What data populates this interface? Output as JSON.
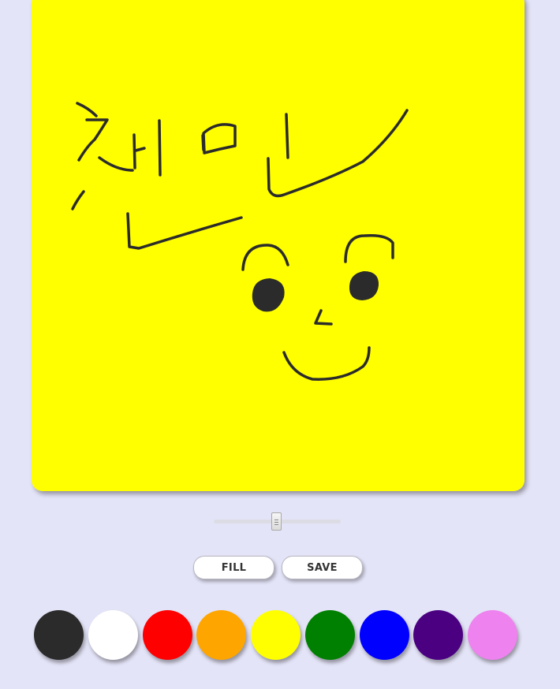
{
  "canvas": {
    "background": "#ffff00",
    "stroke_color": "#2b2b2b",
    "handwritten_text": "챈민"
  },
  "brush_size_slider": {
    "value_fraction": 0.49
  },
  "buttons": {
    "fill_label": "FILL",
    "save_label": "SAVE"
  },
  "palette": [
    {
      "name": "black",
      "color": "#2b2b2b"
    },
    {
      "name": "white",
      "color": "#ffffff"
    },
    {
      "name": "red",
      "color": "#ff0000"
    },
    {
      "name": "orange",
      "color": "#ffa500"
    },
    {
      "name": "yellow",
      "color": "#ffff00"
    },
    {
      "name": "green",
      "color": "#008000"
    },
    {
      "name": "blue",
      "color": "#0000ff"
    },
    {
      "name": "indigo",
      "color": "#4b0082"
    },
    {
      "name": "violet",
      "color": "#ee82ee"
    }
  ]
}
